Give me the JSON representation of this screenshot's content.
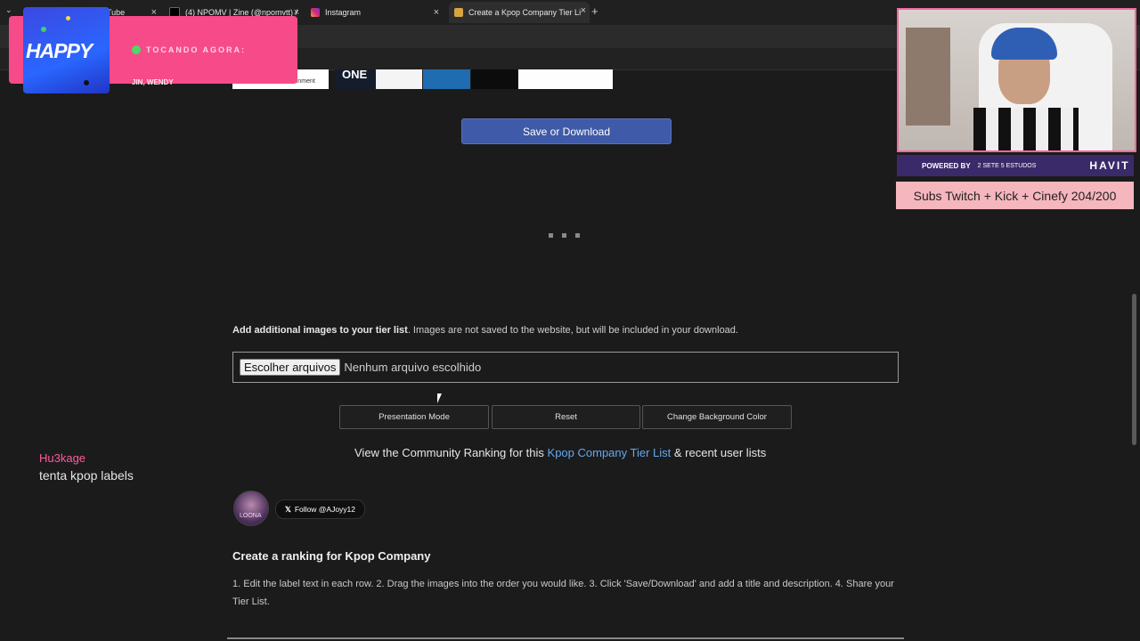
{
  "browser": {
    "tabs": [
      {
        "title": "Tube",
        "active": false
      },
      {
        "title": "(4) NPOMV | Zine (@npomvtt) /",
        "active": false
      },
      {
        "title": "Instagram",
        "active": false
      },
      {
        "title": "Create a Kpop Company Tier Li",
        "active": true
      }
    ],
    "close_glyph": "×",
    "new_tab_glyph": "+",
    "tab_menu_glyph": "⌄"
  },
  "strip_label": "ONE",
  "strip_caption": "entertainment",
  "save_button": "Save or Download",
  "add_images": {
    "bold": "Add additional images to your tier list",
    "rest": ". Images are not saved to the website, but will be included in your download."
  },
  "file_input": {
    "button": "Escolher arquivos",
    "status": "Nenhum arquivo escolhido"
  },
  "controls": {
    "presentation": "Presentation Mode",
    "reset": "Reset",
    "background": "Change Background Color"
  },
  "community": {
    "prefix": "View the Community Ranking for this ",
    "link": "Kpop Company Tier List",
    "suffix": " & recent user lists"
  },
  "follow_button": "Follow @AJoyy12",
  "avatar_text": "LOONA",
  "ranking_heading": "Create a ranking for Kpop Company",
  "instructions": "1. Edit the label text in each row. 2. Drag the images into the order you would like. 3. Click 'Save/Download' and add a title and description. 4. Share your Tier List.",
  "now_playing": {
    "label": "TOCANDO AGORA:",
    "artist": "JIN, WENDY",
    "album_text": "HAPPY"
  },
  "stream": {
    "powered_by": "POWERED BY",
    "sponsor1": "2 SETE 5 ESTUDOS",
    "sponsor2": "HAVIT",
    "subs_goal": "Subs Twitch + Kick + Cinefy  204/200"
  },
  "chat": {
    "user": "Hu3kage",
    "message": "tenta kpop labels"
  },
  "colors": {
    "accent_blue": "#3f5aa8",
    "link": "#63a8ee",
    "overlay_pink": "#f74a89",
    "subs_bg": "#f6b6bd"
  }
}
